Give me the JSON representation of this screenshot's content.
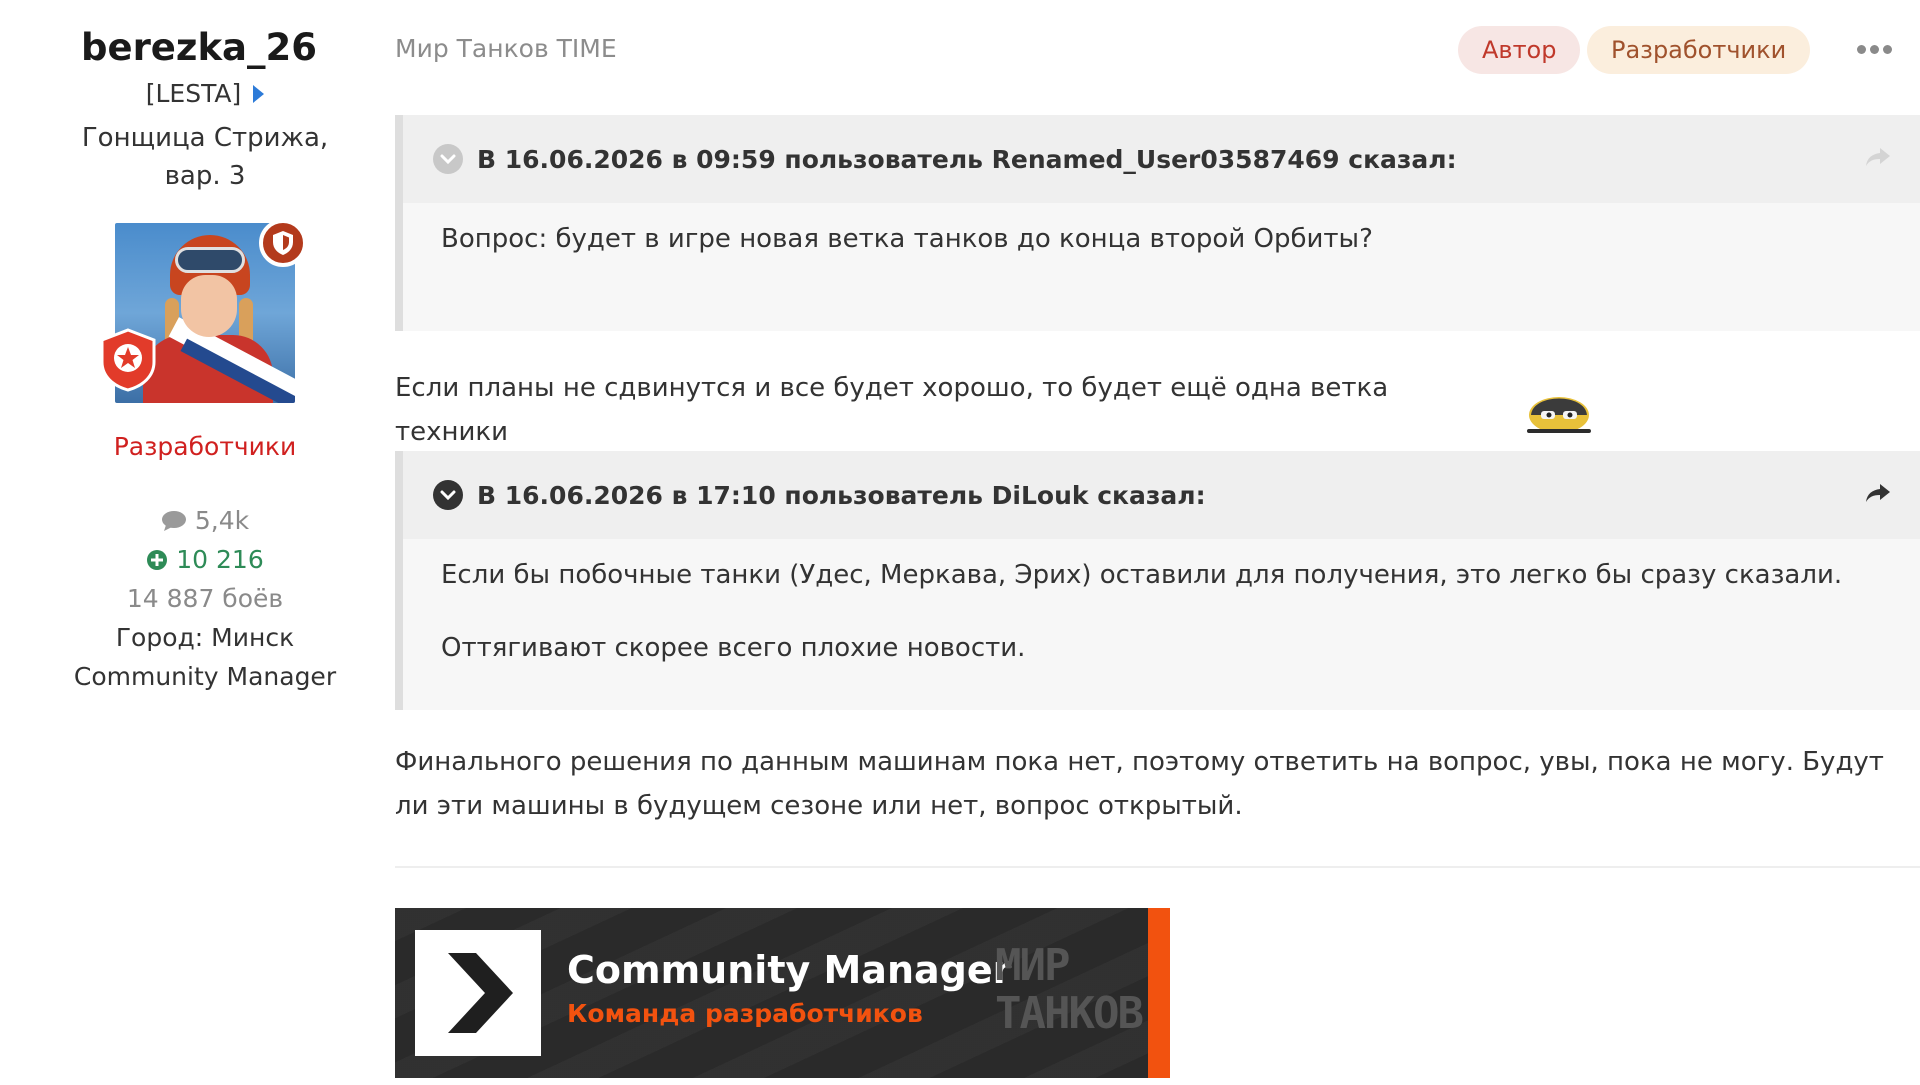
{
  "author": {
    "name": "berezka_26",
    "clan": "[LESTA]",
    "title": "Гонщица Стрижа, вар. 3",
    "role": "Разработчики",
    "stats": {
      "posts": "5,4k",
      "reputation": "10 216",
      "battles": "14 887 боёв",
      "city": "Город: Минск",
      "position": "Community Manager"
    }
  },
  "post_header": {
    "forum": "Мир Танков TIME",
    "badges": [
      "Автор",
      "Разработчики"
    ]
  },
  "quotes": [
    {
      "header": "В 16.06.2026 в 09:59 пользователь Renamed_User03587469 сказал:",
      "paragraphs": [
        "Вопрос: будет в игре новая ветка танков до конца второй Орбиты?"
      ]
    },
    {
      "header": "В 16.06.2026 в 17:10 пользователь DiLouk сказал:",
      "paragraphs": [
        "Если бы побочные танки (Удес, Меркава, Эрих) оставили для получения, это легко бы сразу сказали.",
        "Оттягивают скорее всего плохие новости."
      ]
    }
  ],
  "replies": [
    "Если планы не сдвинутся и все будет хорошо, то будет ещё одна ветка техники",
    "Финального решения по данным машинам пока нет, поэтому ответить на вопрос, увы, пока не могу. Будут ли эти машины в будущем сезоне или нет, вопрос открытый."
  ],
  "signature": {
    "title": "Community Manager",
    "subtitle": "Команда разработчиков",
    "brand_line1": "МИР",
    "brand_line2": "ТАНКОВ"
  },
  "colors": {
    "role": "#d0201f",
    "reputation": "#2e8b57",
    "accent": "#f2520f"
  }
}
